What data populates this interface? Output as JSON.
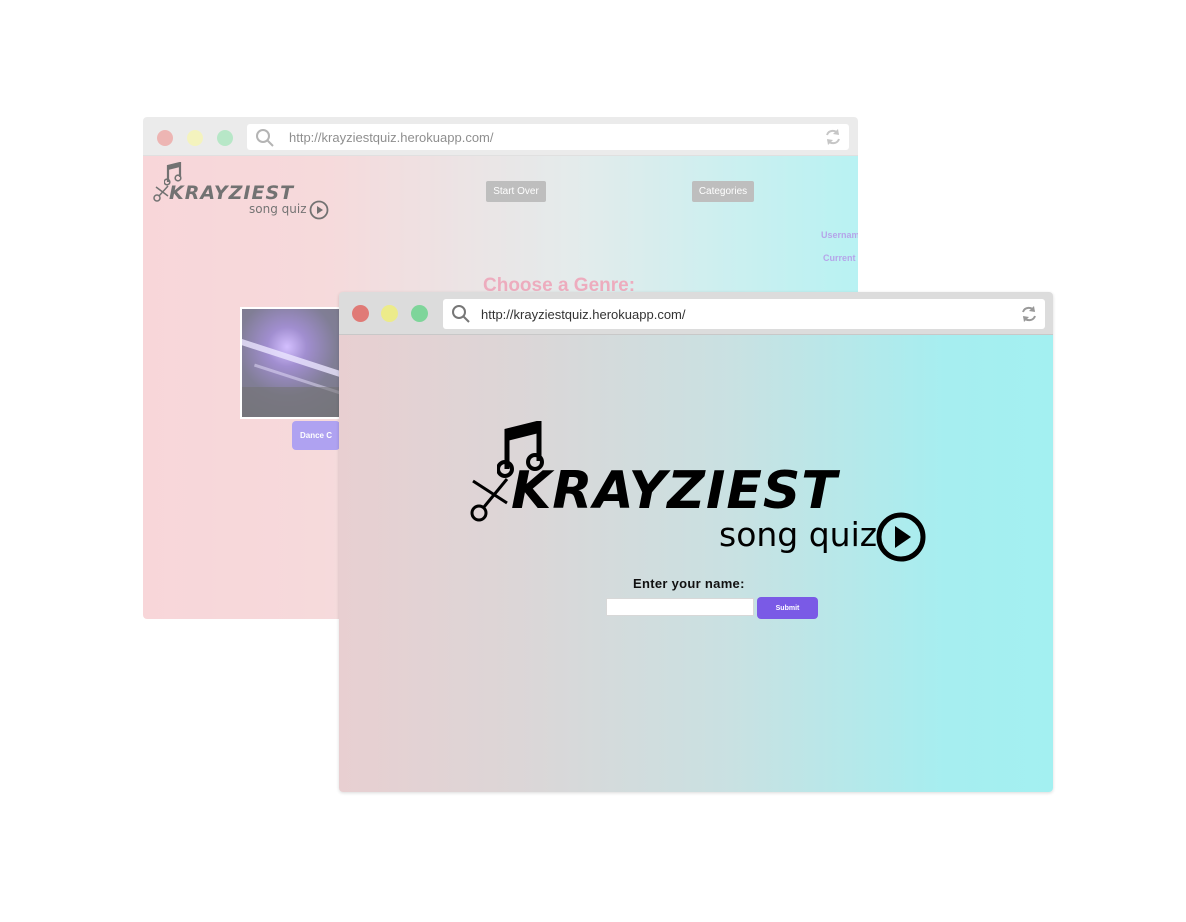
{
  "back_window": {
    "url": "http://krayziestquiz.herokuapp.com/",
    "logo_main": "KRAYZIEST",
    "logo_sub": "song quiz",
    "nav": {
      "start_over": "Start Over",
      "categories": "Categories"
    },
    "side": {
      "username": "Usernam",
      "current": "Current s"
    },
    "genre_title": "Choose a Genre:",
    "genre_button": "Dance C"
  },
  "front_window": {
    "url": "http://krayziestquiz.herokuapp.com/",
    "logo_main": "KRAYZIEST",
    "logo_sub": "song quiz",
    "prompt": "Enter your name:",
    "name_input": {
      "value": "",
      "placeholder": ""
    },
    "submit_label": "Submit"
  },
  "colors": {
    "close": "#e07a76",
    "minimize": "#eceb8a",
    "maximize": "#7ed59a",
    "accent": "#7a5ae6",
    "gradient_left": "#e8cfd1",
    "gradient_right": "#a3f0f1"
  },
  "icons": {
    "search": "magnifier",
    "reload": "circular-arrows",
    "logo_note": "music-note",
    "logo_play": "play-circle",
    "logo_scissors": "scissors"
  }
}
